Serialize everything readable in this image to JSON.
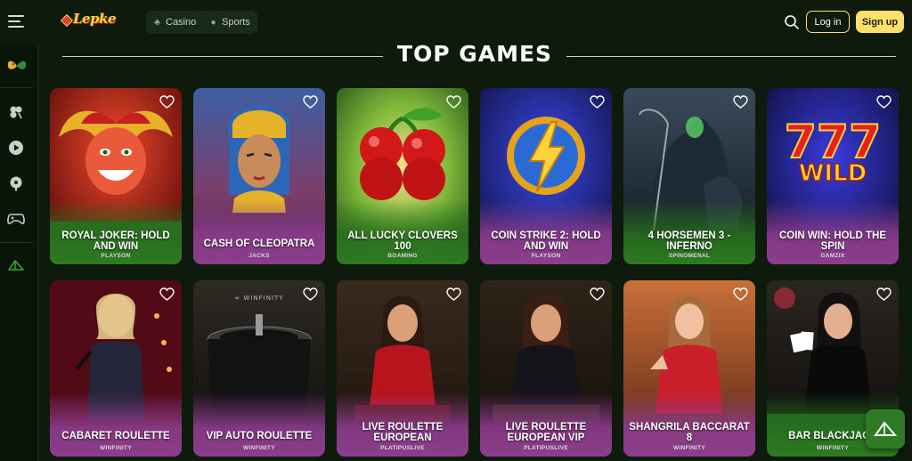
{
  "header": {
    "logo_text": "Lepke",
    "nav": {
      "casino_label": "Casino",
      "sports_label": "Sports"
    },
    "login_label": "Log in",
    "signup_label": "Sign up"
  },
  "section": {
    "title": "TOP GAMES"
  },
  "games": [
    {
      "title": "ROYAL JOKER: HOLD AND WIN",
      "provider": "PLAYSON"
    },
    {
      "title": "CASH OF CLEOPATRA",
      "provider": "JACKS"
    },
    {
      "title": "ALL LUCKY CLOVERS 100",
      "provider": "BGAMING"
    },
    {
      "title": "COIN STRIKE 2: HOLD AND WIN",
      "provider": "PLAYSON"
    },
    {
      "title": "4 HORSEMEN 3 - INFERNO",
      "provider": "SPINOMENAL"
    },
    {
      "title": "COIN WIN: HOLD THE SPIN",
      "provider": "GAMZIX"
    },
    {
      "title": "CABARET ROULETTE",
      "provider": "WINFINITY"
    },
    {
      "title": "VIP AUTO ROULETTE",
      "provider": "WINFINITY"
    },
    {
      "title": "LIVE ROULETTE EUROPEAN",
      "provider": "PLATIPUSLIVE"
    },
    {
      "title": "LIVE ROULETTE EUROPEAN VIP",
      "provider": "PLATIPUSLIVE"
    },
    {
      "title": "SHANGRILA BACCARAT 8",
      "provider": "WINFINITY"
    },
    {
      "title": "BAR BLACKJACK",
      "provider": "WINFINITY"
    }
  ],
  "icons": {
    "menu": "hamburger-icon",
    "casino": "clover-icon",
    "sports": "ball-icon",
    "search": "search-icon",
    "favorite": "heart-icon",
    "chat": "chat-icon"
  },
  "colors": {
    "background": "#0d1a0c",
    "accent": "#ffe06b",
    "brand_green": "#2f7a25"
  }
}
